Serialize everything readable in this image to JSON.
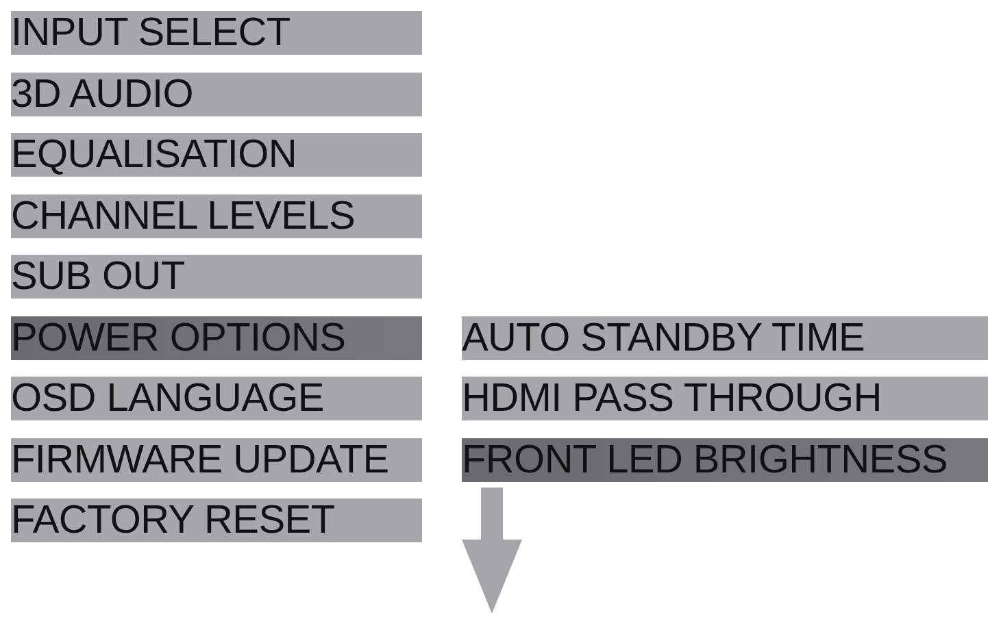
{
  "menu": {
    "items": [
      {
        "label": "INPUT SELECT",
        "selected": false
      },
      {
        "label": "3D AUDIO",
        "selected": false
      },
      {
        "label": "EQUALISATION",
        "selected": false
      },
      {
        "label": "CHANNEL LEVELS",
        "selected": false
      },
      {
        "label": "SUB OUT",
        "selected": false
      },
      {
        "label": "POWER OPTIONS",
        "selected": true,
        "children": [
          {
            "label": "AUTO STANDBY TIME",
            "selected": false
          },
          {
            "label": "HDMI PASS THROUGH",
            "selected": false
          },
          {
            "label": "FRONT LED BRIGHTNESS",
            "selected": true
          }
        ]
      },
      {
        "label": "OSD LANGUAGE",
        "selected": false
      },
      {
        "label": "FIRMWARE UPDATE",
        "selected": false
      },
      {
        "label": "FACTORY RESET",
        "selected": false
      }
    ]
  }
}
